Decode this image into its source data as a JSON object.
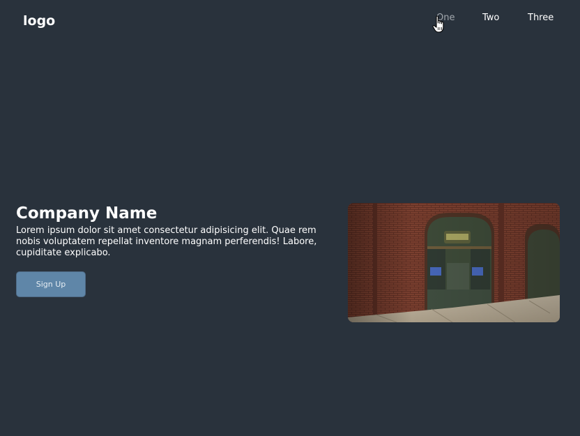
{
  "header": {
    "logo": "logo",
    "nav": [
      "One",
      "Two",
      "Three"
    ]
  },
  "hero": {
    "title": "Company Name",
    "description": "Lorem ipsum dolor sit amet consectetur adipisicing elit. Quae rem nobis voluptatem repellat inventore magnam perferendis! Labore, cupiditate explicabo.",
    "button_label": "Sign Up",
    "image_icon": "storefront-photo"
  },
  "colors": {
    "background": "#29323c",
    "button": "#5f86a8",
    "nav_hover": "#a2a8ae"
  },
  "cursor_icon": "hand-pointer-icon"
}
